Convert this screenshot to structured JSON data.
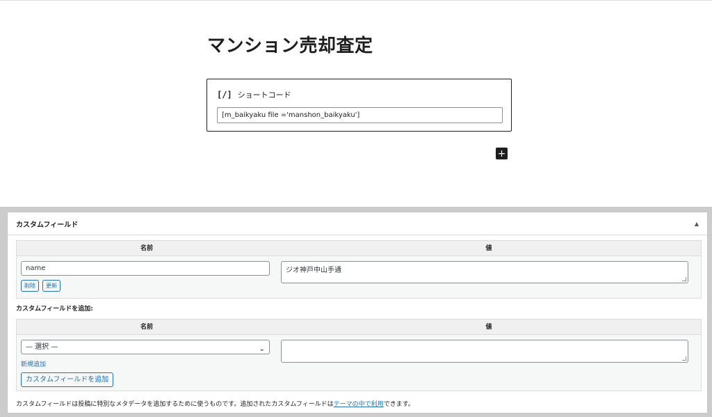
{
  "editor": {
    "post_title": "マンション売却査定",
    "shortcode_block": {
      "icon": "[/]",
      "label": "ショートコード",
      "value": "[m_baikyaku file ='manshon_baikyaku']"
    },
    "inserter_symbol": "+"
  },
  "custom_fields": {
    "title": "カスタムフィールド",
    "toggle_arrow": "▲",
    "existing": {
      "col_name": "名前",
      "col_value": "値",
      "rows": [
        {
          "name": "name",
          "value": "ジオ神戸中山手通",
          "delete_label": "削除",
          "update_label": "更新"
        }
      ]
    },
    "add_heading": "カスタムフィールドを追加:",
    "new": {
      "col_name": "名前",
      "col_value": "値",
      "select_value": "— 選択 —",
      "value": "",
      "new_link": "新規追加",
      "add_button": "カスタムフィールドを追加"
    },
    "help": {
      "before": "カスタムフィールドは投稿に特別なメタデータを追加するために使うものです。追加されたカスタムフィールドは",
      "link": "テーマの中で利用",
      "after": "できます。"
    }
  },
  "colors": {
    "accent": "#2271b1",
    "border": "#8c8f94",
    "meta_bg": "#cccccc"
  }
}
